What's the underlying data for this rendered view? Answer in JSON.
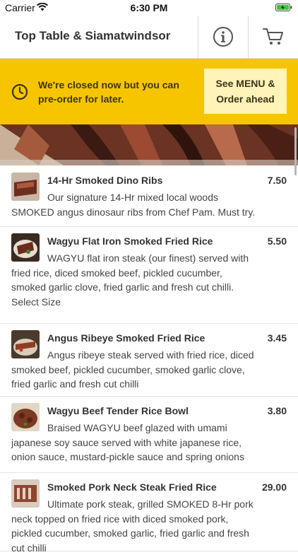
{
  "status_bar": {
    "carrier": "Carrier",
    "time": "6:30 PM"
  },
  "header": {
    "title": "Top Table & Siamatwindsor",
    "info_icon": "info-icon",
    "cart_icon": "cart-icon"
  },
  "banner": {
    "message": "We're closed now but you can pre-order for later.",
    "button_label": "See MENU & Order ahead",
    "icon": "clock-icon",
    "color": "#f7c500"
  },
  "items": [
    {
      "name": "14-Hr Smoked Dino Ribs",
      "price": "7.50",
      "description": "Our signature 14-Hr mixed local woods SMOKED angus dinosaur ribs from Chef Pam. Must try."
    },
    {
      "name": "Wagyu Flat Iron Smoked Fried Rice",
      "price": "5.50",
      "description": "WAGYU flat iron steak (our finest) served with fried rice, diced smoked beef, pickled cucumber, smoked garlic clove, fried garlic and fresh cut chilli. Select Size"
    },
    {
      "name": "Angus Ribeye Smoked Fried Rice",
      "price": "3.45",
      "description": "Angus ribeye steak served with fried rice, diced smoked beef, pickled cucumber, smoked garlic clove, fried garlic and fresh cut chilli"
    },
    {
      "name": "Wagyu Beef Tender Rice Bowl",
      "price": "3.80",
      "description": "Braised WAGYU beef glazed with umami japanese soy sauce served with white japanese rice, onion sauce, mustard-pickle sauce and spring onions"
    },
    {
      "name": "Smoked Pork Neck Steak Fried Rice",
      "price": "29.00",
      "description": "Ultimate pork steak, grilled SMOKED 8-Hr pork neck topped on fried rice with diced smoked pork, pickled cucumber, smoked garlic, fried garlic and fresh cut chilli"
    }
  ]
}
